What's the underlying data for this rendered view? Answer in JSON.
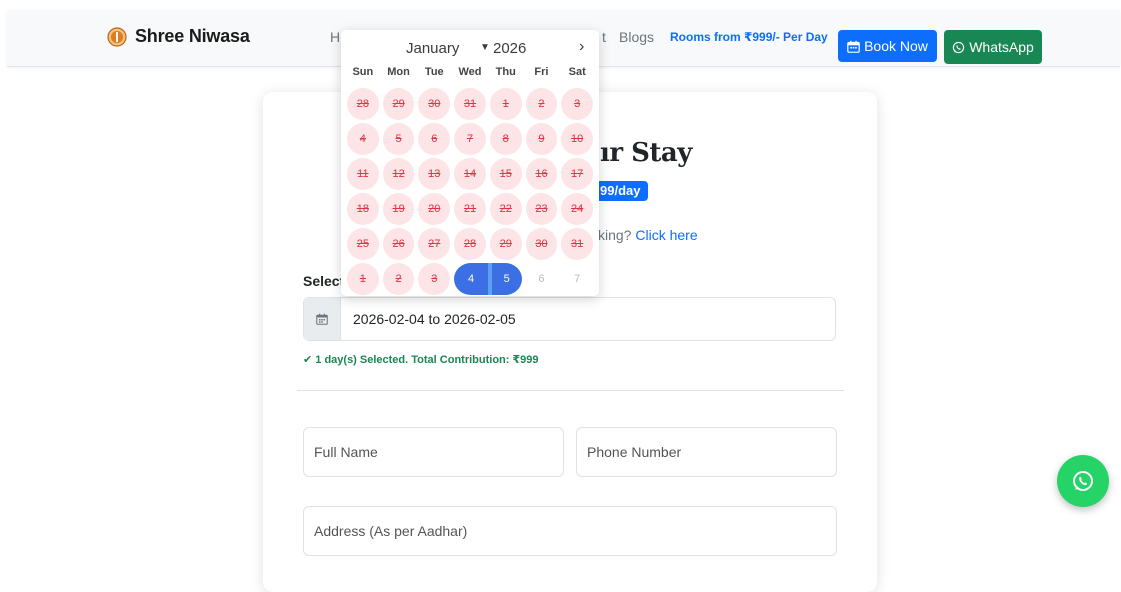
{
  "navbar": {
    "brand": "Shree Niwasa",
    "home_partial": "H",
    "nav_fragment": "t",
    "blogs": "Blogs",
    "rooms": "Rooms from ₹999/- Per Day",
    "book_now": "Book Now",
    "whatsapp": "WhatsApp"
  },
  "form": {
    "heading_partial": "ır Stay",
    "price_partial": "99/day",
    "existing_text": "king?",
    "existing_link": "Click here",
    "select_label": "Select",
    "date_range": "2026-02-04 to 2026-02-05",
    "selected_message": "✔ 1 day(s) Selected. Total Contribution: ₹999",
    "full_name_placeholder": "Full Name",
    "phone_placeholder": "Phone Number",
    "address_placeholder": "Address (As per Aadhar)"
  },
  "datepicker": {
    "month": "January",
    "year": "2026",
    "weekdays": [
      "Sun",
      "Mon",
      "Tue",
      "Wed",
      "Thu",
      "Fri",
      "Sat"
    ],
    "weeks": [
      [
        {
          "d": "28",
          "s": "disabled"
        },
        {
          "d": "29",
          "s": "disabled"
        },
        {
          "d": "30",
          "s": "disabled"
        },
        {
          "d": "31",
          "s": "disabled"
        },
        {
          "d": "1",
          "s": "disabled"
        },
        {
          "d": "2",
          "s": "disabled"
        },
        {
          "d": "3",
          "s": "disabled"
        }
      ],
      [
        {
          "d": "4",
          "s": "disabled"
        },
        {
          "d": "5",
          "s": "disabled"
        },
        {
          "d": "6",
          "s": "disabled"
        },
        {
          "d": "7",
          "s": "disabled"
        },
        {
          "d": "8",
          "s": "disabled"
        },
        {
          "d": "9",
          "s": "disabled"
        },
        {
          "d": "10",
          "s": "disabled"
        }
      ],
      [
        {
          "d": "11",
          "s": "disabled"
        },
        {
          "d": "12",
          "s": "disabled"
        },
        {
          "d": "13",
          "s": "disabled"
        },
        {
          "d": "14",
          "s": "disabled"
        },
        {
          "d": "15",
          "s": "disabled"
        },
        {
          "d": "16",
          "s": "disabled"
        },
        {
          "d": "17",
          "s": "disabled"
        }
      ],
      [
        {
          "d": "18",
          "s": "disabled"
        },
        {
          "d": "19",
          "s": "disabled"
        },
        {
          "d": "20",
          "s": "disabled"
        },
        {
          "d": "21",
          "s": "disabled"
        },
        {
          "d": "22",
          "s": "disabled"
        },
        {
          "d": "23",
          "s": "disabled"
        },
        {
          "d": "24",
          "s": "disabled"
        }
      ],
      [
        {
          "d": "25",
          "s": "disabled"
        },
        {
          "d": "26",
          "s": "disabled"
        },
        {
          "d": "27",
          "s": "disabled"
        },
        {
          "d": "28",
          "s": "disabled"
        },
        {
          "d": "29",
          "s": "disabled"
        },
        {
          "d": "30",
          "s": "disabled"
        },
        {
          "d": "31",
          "s": "disabled"
        }
      ],
      [
        {
          "d": "1",
          "s": "disabled"
        },
        {
          "d": "2",
          "s": "disabled"
        },
        {
          "d": "3",
          "s": "disabled"
        },
        {
          "d": "4",
          "s": "sel-start"
        },
        {
          "d": "5",
          "s": "sel-end"
        },
        {
          "d": "6",
          "s": "muted"
        },
        {
          "d": "7",
          "s": "muted"
        }
      ]
    ]
  },
  "colors": {
    "primary": "#0d6efd",
    "success": "#198754",
    "whatsapp_float": "#25d366",
    "disabled_day_bg": "#fde4e6",
    "disabled_day_text": "#dc3545",
    "selected_day": "#3b6fe3"
  },
  "icons": {
    "brand": "om-logo-icon",
    "book": "calendar-icon",
    "whatsapp": "whatsapp-icon",
    "date_addon": "calendar-icon",
    "next_month": "chevron-right-icon",
    "month_dropdown": "chevron-down-icon"
  }
}
